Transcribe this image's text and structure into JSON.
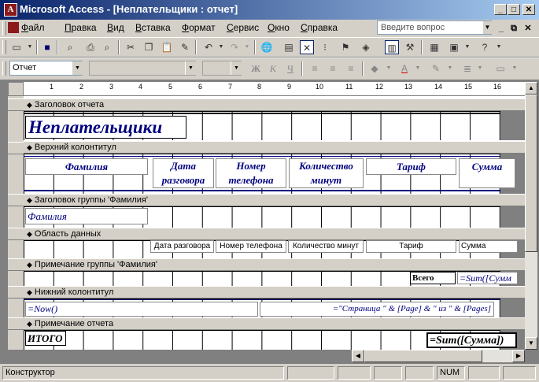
{
  "window": {
    "title": "Microsoft Access - [Неплательщики : отчет]",
    "minimize": "_",
    "maximize": "□",
    "close": "✕"
  },
  "menu": [
    "Файл",
    "Правка",
    "Вид",
    "Вставка",
    "Формат",
    "Сервис",
    "Окно",
    "Справка"
  ],
  "help_box": {
    "placeholder": "Введите вопрос"
  },
  "format_toolbar": {
    "object_combo": "Отчет",
    "font_combo": "",
    "size_combo": ""
  },
  "ruler": [
    "1",
    "2",
    "3",
    "4",
    "5",
    "6",
    "7",
    "8",
    "9",
    "10",
    "11",
    "12",
    "13",
    "14",
    "15",
    "16"
  ],
  "sections": {
    "report_header": "Заголовок отчета",
    "page_header": "Верхний колонтитул",
    "group_header": "Заголовок группы 'Фамилия'",
    "detail": "Область данных",
    "group_footer": "Примечание группы 'Фамилия'",
    "page_footer": "Нижний колонтитул",
    "report_footer": "Примечание отчета"
  },
  "report_title": "Неплательщики",
  "column_headers": {
    "surname": "Фамилия",
    "date": "Дата разговора",
    "phone": "Номер телефона",
    "minutes": "Количество минут",
    "tariff": "Тариф",
    "sum": "Сумма"
  },
  "group_field": "Фамилия",
  "detail_fields": {
    "date": "Дата разговора",
    "phone": "Номер телефона",
    "minutes": "Количество минут",
    "tariff": "Тариф",
    "sum": "Сумма"
  },
  "group_footer": {
    "label": "Всего",
    "expr": "=Sum([Сумм"
  },
  "page_footer": {
    "now": "=Now()",
    "pages": "=\"Страница \" & [Page] & \" из \" & [Pages]"
  },
  "report_footer": {
    "label": "ИТОГО",
    "expr": "=Sum([Сумма])"
  },
  "status": {
    "mode": "Конструктор",
    "num": "NUM"
  }
}
